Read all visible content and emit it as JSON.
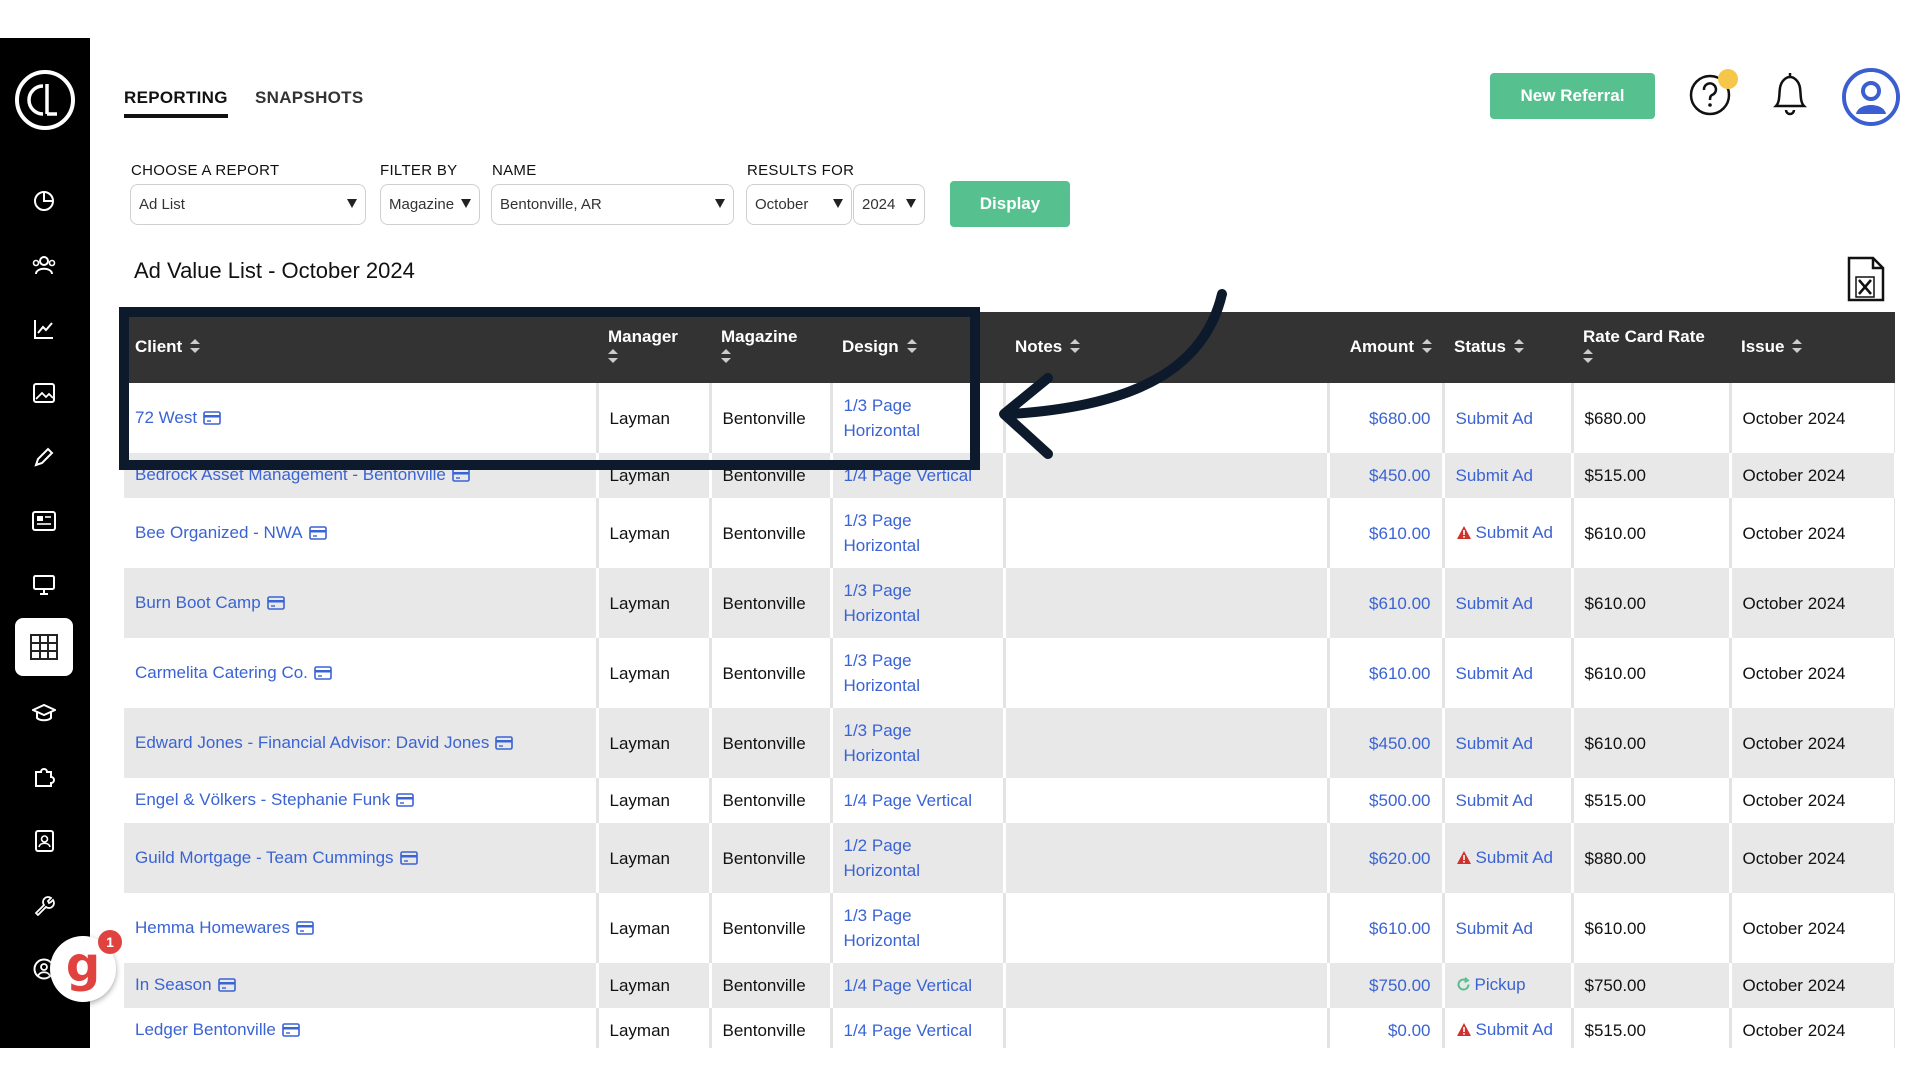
{
  "tabs": [
    {
      "label": "REPORTING",
      "active": true
    },
    {
      "label": "SNAPSHOTS",
      "active": false
    }
  ],
  "header": {
    "new_referral_label": "New Referral",
    "help_icon": "question-mark-icon",
    "notifications_icon": "bell-icon",
    "profile_icon": "user-avatar-icon",
    "accent_color": "#56c08f"
  },
  "sidebar": {
    "logo": "company-logo",
    "items": [
      {
        "icon": "pie-chart-icon"
      },
      {
        "icon": "people-icon"
      },
      {
        "icon": "line-chart-icon"
      },
      {
        "icon": "image-icon"
      },
      {
        "icon": "pencil-icon"
      },
      {
        "icon": "newspaper-icon"
      },
      {
        "icon": "monitor-icon"
      },
      {
        "icon": "table-grid-icon",
        "active": true
      },
      {
        "icon": "graduation-cap-icon"
      },
      {
        "icon": "puzzle-icon"
      },
      {
        "icon": "contact-book-icon"
      },
      {
        "icon": "wrench-icon"
      },
      {
        "icon": "user-circle-icon"
      }
    ]
  },
  "filters": {
    "report_label": "CHOOSE A REPORT",
    "report_value": "Ad List",
    "filter_label": "FILTER BY",
    "filter_value": "Magazine",
    "name_label": "NAME",
    "name_value": "Bentonville, AR",
    "results_label": "RESULTS FOR",
    "month_value": "October",
    "year_value": "2024",
    "display_label": "Display"
  },
  "report": {
    "title": "Ad Value List - October 2024",
    "export_icon": "excel-file-icon"
  },
  "table": {
    "headers": {
      "client": "Client",
      "manager": "Manager",
      "magazine": "Magazine",
      "design": "Design",
      "notes": "Notes",
      "amount": "Amount",
      "status": "Status",
      "rate_card": "Rate Card Rate",
      "issue": "Issue"
    },
    "rows": [
      {
        "client": "72 West",
        "manager": "Layman",
        "magazine": "Bentonville",
        "design": "1/3 Page Horizontal",
        "notes": "",
        "amount": "$680.00",
        "status": "Submit Ad",
        "status_icon": "",
        "rate": "$680.00",
        "issue": "October 2024"
      },
      {
        "client": "Bedrock Asset Management - Bentonville",
        "manager": "Layman",
        "magazine": "Bentonville",
        "design": "1/4 Page Vertical",
        "notes": "",
        "amount": "$450.00",
        "status": "Submit Ad",
        "status_icon": "",
        "rate": "$515.00",
        "issue": "October 2024"
      },
      {
        "client": "Bee Organized - NWA",
        "manager": "Layman",
        "magazine": "Bentonville",
        "design": "1/3 Page Horizontal",
        "notes": "",
        "amount": "$610.00",
        "status": "Submit Ad",
        "status_icon": "warning-icon",
        "rate": "$610.00",
        "issue": "October 2024"
      },
      {
        "client": "Burn Boot Camp",
        "manager": "Layman",
        "magazine": "Bentonville",
        "design": "1/3 Page Horizontal",
        "notes": "",
        "amount": "$610.00",
        "status": "Submit Ad",
        "status_icon": "",
        "rate": "$610.00",
        "issue": "October 2024"
      },
      {
        "client": "Carmelita Catering Co.",
        "manager": "Layman",
        "magazine": "Bentonville",
        "design": "1/3 Page Horizontal",
        "notes": "",
        "amount": "$610.00",
        "status": "Submit Ad",
        "status_icon": "",
        "rate": "$610.00",
        "issue": "October 2024"
      },
      {
        "client": "Edward Jones - Financial Advisor: David Jones",
        "manager": "Layman",
        "magazine": "Bentonville",
        "design": "1/3 Page Horizontal",
        "notes": "",
        "amount": "$450.00",
        "status": "Submit Ad",
        "status_icon": "",
        "rate": "$610.00",
        "issue": "October 2024"
      },
      {
        "client": "Engel & Völkers - Stephanie Funk",
        "manager": "Layman",
        "magazine": "Bentonville",
        "design": "1/4 Page Vertical",
        "notes": "",
        "amount": "$500.00",
        "status": "Submit Ad",
        "status_icon": "",
        "rate": "$515.00",
        "issue": "October 2024"
      },
      {
        "client": "Guild Mortgage - Team Cummings",
        "manager": "Layman",
        "magazine": "Bentonville",
        "design": "1/2 Page Horizontal",
        "notes": "",
        "amount": "$620.00",
        "status": "Submit Ad",
        "status_icon": "warning-icon",
        "rate": "$880.00",
        "issue": "October 2024"
      },
      {
        "client": "Hemma Homewares",
        "manager": "Layman",
        "magazine": "Bentonville",
        "design": "1/3 Page Horizontal",
        "notes": "",
        "amount": "$610.00",
        "status": "Submit Ad",
        "status_icon": "",
        "rate": "$610.00",
        "issue": "October 2024"
      },
      {
        "client": "In Season",
        "manager": "Layman",
        "magazine": "Bentonville",
        "design": "1/4 Page Vertical",
        "notes": "",
        "amount": "$750.00",
        "status": "Pickup",
        "status_icon": "refresh-icon",
        "rate": "$750.00",
        "issue": "October 2024"
      },
      {
        "client": "Ledger Bentonville",
        "manager": "Layman",
        "magazine": "Bentonville",
        "design": "1/4 Page Vertical",
        "notes": "",
        "amount": "$0.00",
        "status": "Submit Ad",
        "status_icon": "warning-icon",
        "rate": "$515.00",
        "issue": "October 2024"
      }
    ]
  },
  "chat_badge": {
    "icon": "g-logo-icon",
    "letter": "g",
    "count": "1"
  }
}
